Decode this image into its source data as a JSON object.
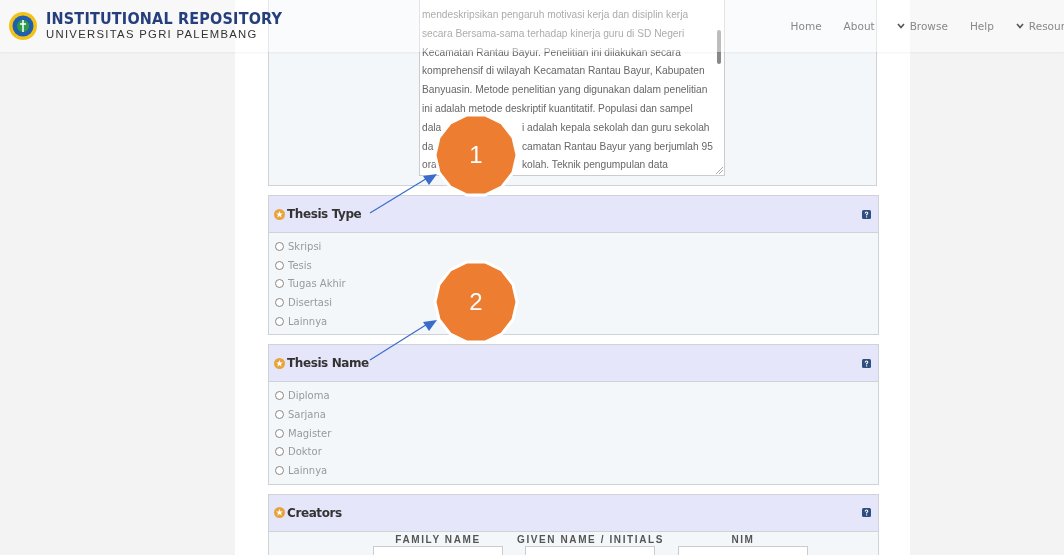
{
  "header": {
    "title": "INSTITUTIONAL REPOSITORY",
    "subtitle": "UNIVERSITAS PGRI PALEMBANG",
    "nav": [
      {
        "label": "Home",
        "dropdown": false
      },
      {
        "label": "About",
        "dropdown": false
      },
      {
        "label": "Browse",
        "dropdown": true
      },
      {
        "label": "Help",
        "dropdown": false
      },
      {
        "label": "Resour",
        "dropdown": true
      }
    ]
  },
  "abstract": {
    "lines": [
      {
        "text": "mendeskripsikan pengaruh motivasi kerja dan disiplin kerja"
      },
      {
        "text": "secara Bersama-sama terhadap kinerja guru di SD Negeri"
      },
      {
        "text": "Kecamatan Rantau Bayur. Penelitian ini dilakukan secara"
      },
      {
        "text": "komprehensif di wilayah Kecamatan Rantau Bayur, Kabupaten"
      },
      {
        "text": "Banyuasin. Metode penelitian yang digunakan dalam penelitian"
      },
      {
        "text": "ini adalah metode deskriptif kuantitatif. Populasi dan sampel"
      },
      {
        "text": "dala",
        "after": "i adalah kepala sekolah dan guru sekolah"
      },
      {
        "text": "da",
        "after": "camatan Rantau Bayur yang berjumlah 95"
      },
      {
        "text": "ora",
        "after": "kolah. Teknik pengumpulan data"
      }
    ]
  },
  "sections": [
    {
      "title": "Thesis Type",
      "kind": "radio",
      "options": [
        {
          "label": "Skripsi",
          "selected": false
        },
        {
          "label": "Tesis",
          "selected": false
        },
        {
          "label": "Tugas Akhir",
          "selected": false
        },
        {
          "label": "Disertasi",
          "selected": false
        },
        {
          "label": "Lainnya",
          "selected": false
        }
      ]
    },
    {
      "title": "Thesis Name",
      "kind": "radio",
      "options": [
        {
          "label": "Diploma",
          "selected": false
        },
        {
          "label": "Sarjana",
          "selected": false
        },
        {
          "label": "Magister",
          "selected": false
        },
        {
          "label": "Doktor",
          "selected": false
        },
        {
          "label": "Lainnya",
          "selected": false
        }
      ]
    },
    {
      "title": "Creators",
      "kind": "table",
      "columns": [
        "FAMILY NAME",
        "GIVEN NAME / INITIALS",
        "NIM"
      ]
    }
  ],
  "annotations": [
    {
      "number": "1"
    },
    {
      "number": "2"
    }
  ]
}
